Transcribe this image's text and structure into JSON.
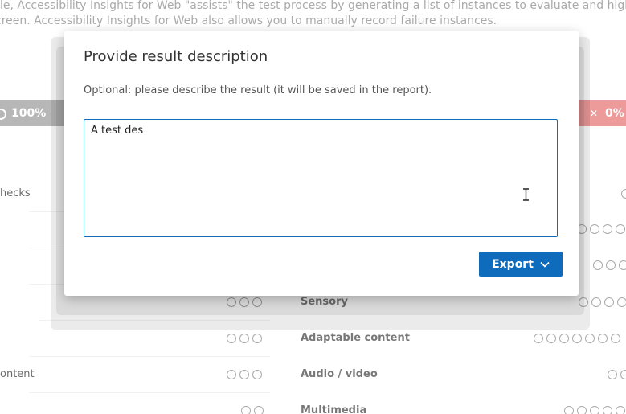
{
  "intro": {
    "line1": "le, Accessibility Insights for Web \"assists\" the test process by generating a list of instances to evaluate and highlighting",
    "line2": "creen. Accessibility Insights for Web also allows you to manually record failure instances."
  },
  "summary": {
    "left_value": "100%",
    "right_value": "0%"
  },
  "list": {
    "left_labels": [
      "hecks",
      "ontent"
    ],
    "right_labels": [
      "Sensory",
      "Adaptable content",
      "Audio / video",
      "Multimedia"
    ]
  },
  "dialog": {
    "title": "Provide result description",
    "description": "Optional: please describe the result (it will be saved in the report).",
    "textarea_value": "A test des",
    "export_label": "Export"
  },
  "colors": {
    "accent": "#0f6cbd",
    "pass_bar": "#9b9b9b",
    "fail_bar": "#e57373"
  }
}
